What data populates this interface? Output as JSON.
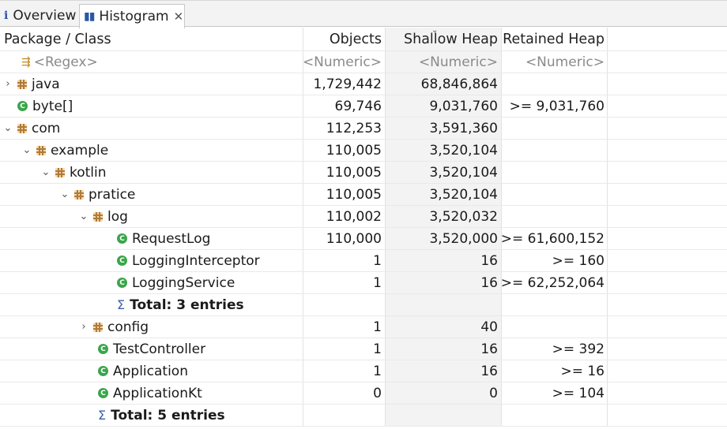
{
  "tabs": [
    {
      "label": "Overview",
      "icon": "info-icon",
      "active": false
    },
    {
      "label": "Histogram",
      "icon": "histogram-icon",
      "active": true
    }
  ],
  "columns": {
    "name": "Package / Class",
    "objects": "Objects",
    "shallow": "Shallow Heap",
    "retained": "Retained Heap"
  },
  "filters": {
    "name": "<Regex>",
    "objects": "<Numeric>",
    "shallow": "<Numeric>",
    "retained": "<Numeric>"
  },
  "rows": [
    {
      "name": "java",
      "objects": "1,729,442",
      "shallow": "68,846,864",
      "retained": ""
    },
    {
      "name": "byte[]",
      "objects": "69,746",
      "shallow": "9,031,760",
      "retained": ">= 9,031,760"
    },
    {
      "name": "com",
      "objects": "112,253",
      "shallow": "3,591,360",
      "retained": ""
    },
    {
      "name": "example",
      "objects": "110,005",
      "shallow": "3,520,104",
      "retained": ""
    },
    {
      "name": "kotlin",
      "objects": "110,005",
      "shallow": "3,520,104",
      "retained": ""
    },
    {
      "name": "pratice",
      "objects": "110,005",
      "shallow": "3,520,104",
      "retained": ""
    },
    {
      "name": "log",
      "objects": "110,002",
      "shallow": "3,520,032",
      "retained": ""
    },
    {
      "name": "RequestLog",
      "objects": "110,000",
      "shallow": "3,520,000",
      "retained": ">= 61,600,152"
    },
    {
      "name": "LoggingInterceptor",
      "objects": "1",
      "shallow": "16",
      "retained": ">= 160"
    },
    {
      "name": "LoggingService",
      "objects": "1",
      "shallow": "16",
      "retained": ">= 62,252,064"
    },
    {
      "name": "Total: 3 entries",
      "objects": "",
      "shallow": "",
      "retained": ""
    },
    {
      "name": "config",
      "objects": "1",
      "shallow": "40",
      "retained": ""
    },
    {
      "name": "TestController",
      "objects": "1",
      "shallow": "16",
      "retained": ">= 392"
    },
    {
      "name": "Application",
      "objects": "1",
      "shallow": "16",
      "retained": ">= 16"
    },
    {
      "name": "ApplicationKt",
      "objects": "0",
      "shallow": "0",
      "retained": ">= 104"
    },
    {
      "name": "Total: 5 entries",
      "objects": "",
      "shallow": "",
      "retained": ""
    }
  ]
}
